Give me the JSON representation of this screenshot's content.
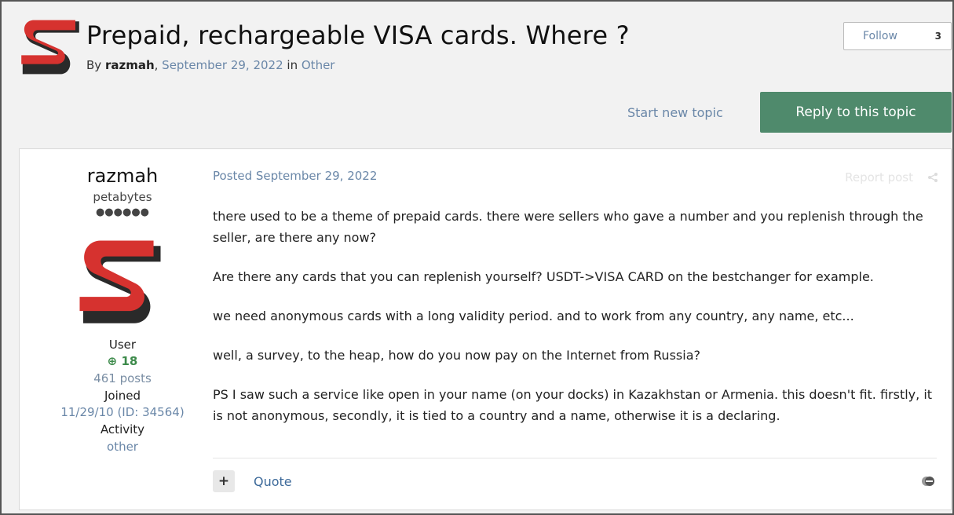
{
  "topic": {
    "title": "Prepaid, rechargeable VISA cards. Where ?",
    "by_prefix": "By ",
    "author": "razmah",
    "sep": ", ",
    "date": "September 29, 2022",
    "in_text": " in ",
    "forum": "Other"
  },
  "follow": {
    "label": "Follow",
    "count": "3"
  },
  "actions": {
    "start_new": "Start new topic",
    "reply": "Reply to this topic"
  },
  "post": {
    "posted": "Posted September 29, 2022",
    "report": "Report post",
    "paragraphs": [
      "there used to be a theme of prepaid cards. there were sellers who gave a number and you replenish through the seller, are there any now?",
      "Are there any cards that you can replenish yourself? USDT->VISA CARD on the bestchanger for example.",
      "we need anonymous cards with a long validity period. and to work from any country, any name, etc...",
      "well, a survey, to the heap, how do you now pay on the Internet from Russia?",
      "PS I saw such a service like open in your name (on your docks) in Kazakhstan or Armenia. this doesn't fit. firstly, it is not anonymous, secondly, it is tied to a country and a name, otherwise it is a declaring."
    ],
    "quote": "Quote",
    "plus": "+"
  },
  "user": {
    "name": "razmah",
    "title": "petabytes",
    "pips": "●●●●●●",
    "group": "User",
    "reputation": "⊕ 18",
    "posts": "461 posts",
    "joined_label": "Joined",
    "joined_value": "11/29/10 (ID: 34564)",
    "activity_label": "Activity",
    "activity_value": "other"
  },
  "colors": {
    "accent_green": "#4f8a6c",
    "logo_red": "#d6322f",
    "logo_dark": "#2a2a2a",
    "link": "#6a87a8"
  },
  "icons": {
    "logo": "forum-logo-icon",
    "share": "share-icon",
    "react": "reaction-icon"
  }
}
